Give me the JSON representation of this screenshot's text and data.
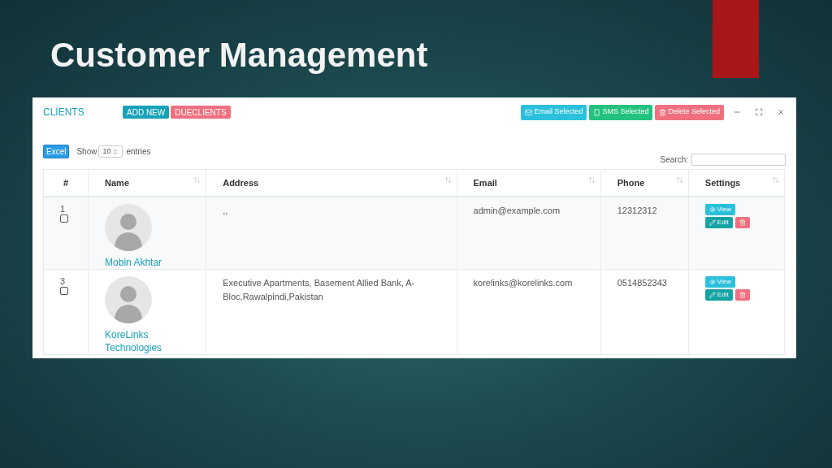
{
  "slide": {
    "title": "Customer Management"
  },
  "panel": {
    "title": "CLIENTS",
    "buttons": [
      {
        "label": "ADD NEW",
        "kind": "add"
      },
      {
        "label": "DUECLIENTS",
        "kind": "due"
      }
    ],
    "actions": [
      {
        "label": "Email Selected",
        "kind": "email"
      },
      {
        "label": "SMS Selected",
        "kind": "sms"
      },
      {
        "label": "Delete Selected",
        "kind": "delete"
      }
    ]
  },
  "toolbar": {
    "export": "Excel",
    "show_label": "Show",
    "page_size": "10",
    "entries_label": "entries",
    "search_label": "Search:"
  },
  "table": {
    "columns": [
      "#",
      "Name",
      "Address",
      "Email",
      "Phone",
      "Settings"
    ],
    "rows": [
      {
        "index": "1",
        "checked": false,
        "name": "Mobin Akhtar",
        "address": ",,",
        "email": "admin@example.com",
        "phone": "12312312",
        "view": "View",
        "edit": "Edit"
      },
      {
        "index": "3",
        "checked": false,
        "name": "KoreLinks Technologies",
        "address": "Executive Apartments, Basement Allied Bank, A-Bloc,Rawalpindi,Pakistan",
        "email": "korelinks@korelinks.com",
        "phone": "0514852343",
        "view": "View",
        "edit": "Edit"
      }
    ]
  }
}
